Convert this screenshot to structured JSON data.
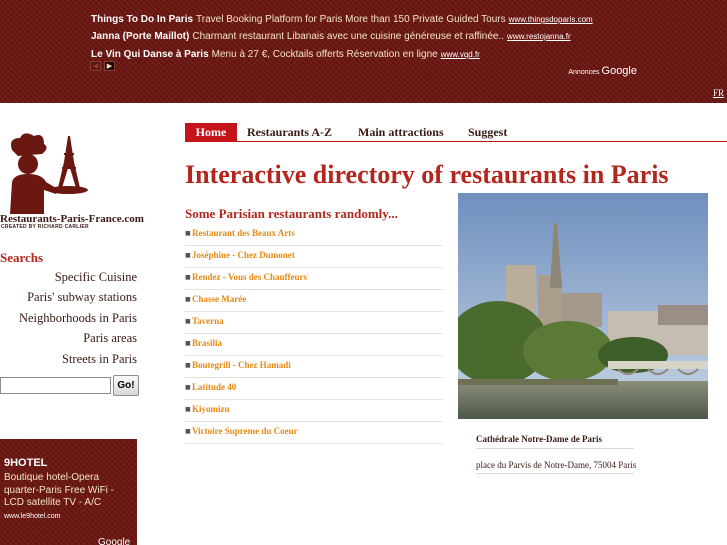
{
  "top_ads": [
    {
      "title": "Things To Do In Paris",
      "text": "Travel Booking Platform for Paris More than 150 Private Guided Tours",
      "url": "www.thingsdoparis.com"
    },
    {
      "title": "Janna (Porte Maillot)",
      "text": "Charmant restaurant Libanais avec une cuisine généreuse et raffinée..",
      "url": "www.restojanna.fr"
    },
    {
      "title": "Le Vin Qui Danse à Paris",
      "text": "Menu à 27 €, Cocktails offerts Réservation en ligne",
      "url": "www.vqd.fr"
    }
  ],
  "ads_label": "Annonces",
  "ads_provider": "Google",
  "language_link": "FR",
  "logo": {
    "name": "Restaurants-Paris-France.com",
    "credit": "CREATED BY RICHARD CARLIER"
  },
  "nav": {
    "home": "Home",
    "az": "Restaurants A-Z",
    "attractions": "Main attractions",
    "suggest": "Suggest"
  },
  "page_title": "Interactive directory of restaurants in Paris",
  "sidebar": {
    "title": "Searchs",
    "links": [
      "Specific Cuisine",
      "Paris' subway stations",
      "Neighborhoods in Paris",
      "Paris areas",
      "Streets in Paris"
    ],
    "search": {
      "value": "",
      "button": "Go!"
    }
  },
  "side_ad": {
    "title": "9HOTEL",
    "text": "Boutique hotel-Opera quarter-Paris Free WiFi - LCD satellite TV - A/C",
    "url": "www.le9hotel.com",
    "provider": "Google"
  },
  "random": {
    "title": "Some Parisian restaurants randomly...",
    "items": [
      "Restaurant des Beaux Arts",
      "Joséphine - Chez Dumonet",
      "Rendez - Vous des Chauffeurs",
      "Chasse Marée",
      "Taverna",
      "Brasilia",
      "Boutegrill - Chez Hamadi",
      "Latitude 40",
      "Kiyomizu",
      "Victoire Supreme du Coeur"
    ]
  },
  "photo": {
    "caption": "Cathédrale Notre-Dame de Paris",
    "address": "place du Parvis de Notre-Dame, 75004 Paris"
  },
  "colors": {
    "brand_red": "#c4141a",
    "banner_bg": "#6b1712",
    "link_orange": "#e48a12",
    "title_red": "#b3261e"
  }
}
